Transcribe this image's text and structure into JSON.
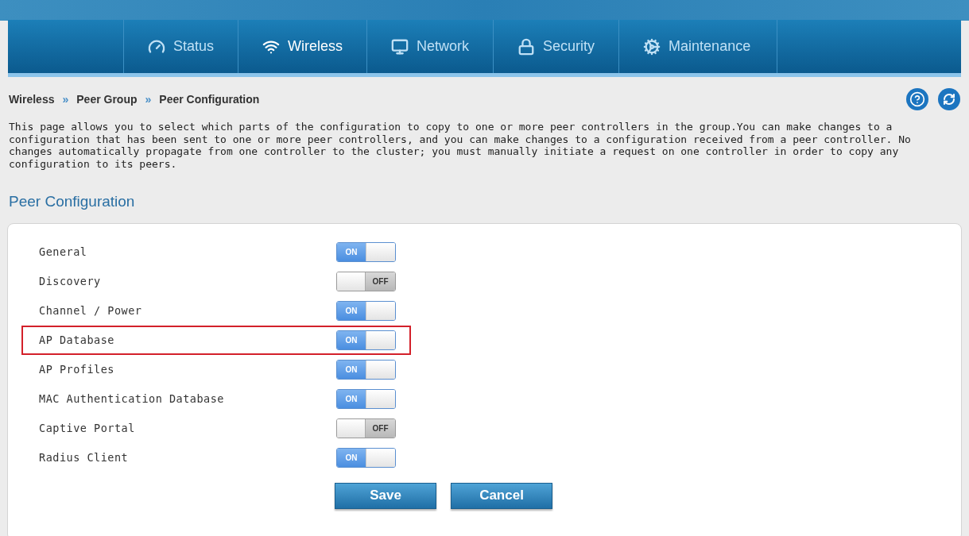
{
  "nav": [
    {
      "label": "Status",
      "selected": false
    },
    {
      "label": "Wireless",
      "selected": true
    },
    {
      "label": "Network",
      "selected": false
    },
    {
      "label": "Security",
      "selected": false
    },
    {
      "label": "Maintenance",
      "selected": false
    }
  ],
  "breadcrumb": [
    "Wireless",
    "»",
    "Peer Group",
    "»",
    "Peer Configuration"
  ],
  "description": "This page allows you to select which parts of the configuration to copy to one or more peer controllers in the group.You can make changes to a configuration that has been sent to one or more peer controllers, and you can make changes to a configuration received from a peer controller. No changes automatically propagate from one controller to the cluster; you must manually initiate a request on one controller in order to copy any configuration to its peers.",
  "section_title": "Peer Configuration",
  "settings": [
    {
      "label": "General",
      "on": true,
      "state_text": "ON",
      "highlighted": false
    },
    {
      "label": "Discovery",
      "on": false,
      "state_text": "OFF",
      "highlighted": false
    },
    {
      "label": "Channel / Power",
      "on": true,
      "state_text": "ON",
      "highlighted": false
    },
    {
      "label": "AP Database",
      "on": true,
      "state_text": "ON",
      "highlighted": true
    },
    {
      "label": "AP Profiles",
      "on": true,
      "state_text": "ON",
      "highlighted": false
    },
    {
      "label": "MAC Authentication Database",
      "on": true,
      "state_text": "ON",
      "highlighted": false
    },
    {
      "label": "Captive Portal",
      "on": false,
      "state_text": "OFF",
      "highlighted": false
    },
    {
      "label": "Radius Client",
      "on": true,
      "state_text": "ON",
      "highlighted": false
    }
  ],
  "buttons": [
    "Save",
    "Cancel"
  ]
}
